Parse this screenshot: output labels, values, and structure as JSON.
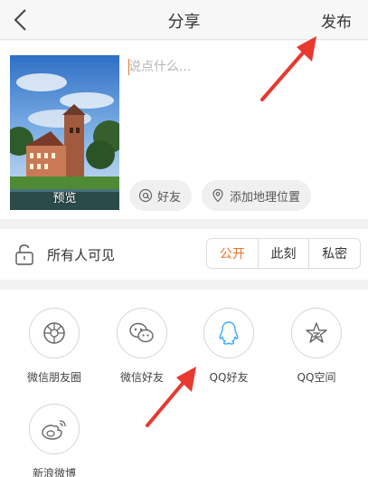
{
  "header": {
    "title": "分享",
    "publish_label": "发布"
  },
  "compose": {
    "placeholder": "说点什么...",
    "preview_label": "预览",
    "chips": {
      "friends": "好友",
      "location": "添加地理位置"
    }
  },
  "visibility": {
    "label": "所有人可见",
    "options": [
      "公开",
      "此刻",
      "私密"
    ],
    "selected": "公开"
  },
  "share": {
    "targets": [
      {
        "label": "微信朋友圈",
        "icon": "wechat-moments-icon"
      },
      {
        "label": "微信好友",
        "icon": "wechat-icon"
      },
      {
        "label": "QQ好友",
        "icon": "qq-icon"
      },
      {
        "label": "QQ空间",
        "icon": "qzone-icon"
      },
      {
        "label": "新浪微博",
        "icon": "weibo-icon"
      }
    ]
  },
  "colors": {
    "accent": "#e8772e",
    "qq_blue": "#3fa9f5",
    "arrow_red": "#e8382f"
  }
}
